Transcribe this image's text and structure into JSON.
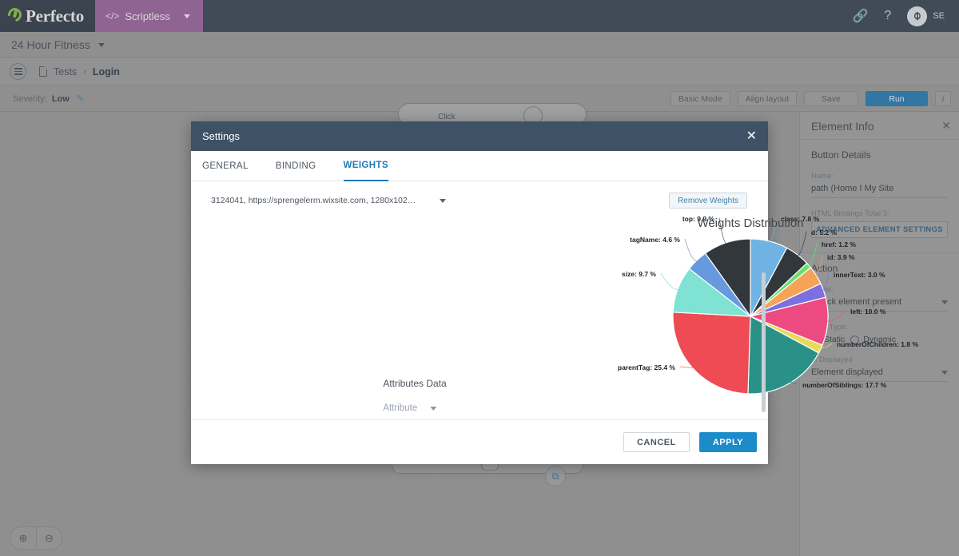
{
  "topnav": {
    "brand": "Perfecto",
    "module_tab": "Scriptless",
    "code_icon": "</>",
    "link_icon": "link-icon",
    "help_icon": "?",
    "user_initials": "SE"
  },
  "project_bar": {
    "title": "24 Hour Fitness"
  },
  "breadcrumb": {
    "root": "Tests",
    "separator": "›",
    "current": "Login"
  },
  "toolbar": {
    "severity_label": "Severity:",
    "severity_value": "Low",
    "edit_icon": "pencil-icon",
    "basic_mode": "Basic Mode",
    "align_layout": "Align layout",
    "save": "Save",
    "run": "Run",
    "info": "i"
  },
  "canvas": {
    "node_label": "Click",
    "zoom_in": "⊕",
    "zoom_out": "⊖"
  },
  "right_panel": {
    "title": "Element Info",
    "close": "✕",
    "section_details": "Button Details",
    "name_label": "Name:",
    "name_value": "path (Home I My Site",
    "bindings_label": "HTML Bindings Total 3:",
    "advanced_button": "ADVANCED ELEMENT SETTINGS",
    "section_action": "Action",
    "action_name_label": "Name:",
    "action_name_value": "Check element present",
    "data_type_label": "Data Type:",
    "data_type_static": "Static",
    "data_type_dynamic": "Dynamic",
    "data_type_selected": "Static",
    "is_displayed_label": "Is Displayed",
    "is_displayed_value": "Element displayed"
  },
  "modal": {
    "title": "Settings",
    "close": "✕",
    "tabs": [
      {
        "label": "GENERAL",
        "active": false
      },
      {
        "label": "BINDING",
        "active": false
      },
      {
        "label": "WEIGHTS",
        "active": true
      }
    ],
    "source_select": "3124041, https://sprengelerm.wixsite.com, 1280x102…",
    "remove_weights": "Remove Weights",
    "attributes_title": "Attributes Data",
    "attribute_placeholder": "Attribute",
    "cancel": "CANCEL",
    "apply": "APPLY"
  },
  "chart_data": {
    "type": "pie",
    "title": "Weights Distribution",
    "unit": "%",
    "label_format": "{name}: {value} %",
    "start_angle_deg": 0,
    "direction": "clockwise",
    "categories": [
      "class",
      "d",
      "href",
      "id",
      "innerText",
      "left",
      "numberOfChildren",
      "numberOfSiblings",
      "parentTag",
      "size",
      "tagName",
      "top"
    ],
    "values": [
      7.8,
      5.2,
      1.2,
      3.9,
      3.0,
      10.0,
      1.8,
      17.7,
      25.4,
      9.7,
      4.6,
      9.9
    ],
    "colors": [
      "#6FB3E5",
      "#32373C",
      "#6BE06B",
      "#F5A457",
      "#7C6FE0",
      "#EC4A80",
      "#E8DB5A",
      "#2A9188",
      "#EE4B55",
      "#7FE2D2",
      "#6699DD",
      "#32373C"
    ],
    "labels": [
      "class: 7.8 %",
      "d: 5.2 %",
      "href: 1.2 %",
      "id: 3.9 %",
      "innerText: 3.0 %",
      "left: 10.0 %",
      "numberOfChildren: 1.8 %",
      "numberOfSiblings: 17.7 %",
      "parentTag: 25.4 %",
      "size: 9.7 %",
      "tagName: 4.6 %",
      "top: 9.9 %"
    ],
    "legend": "none",
    "grid": false
  }
}
